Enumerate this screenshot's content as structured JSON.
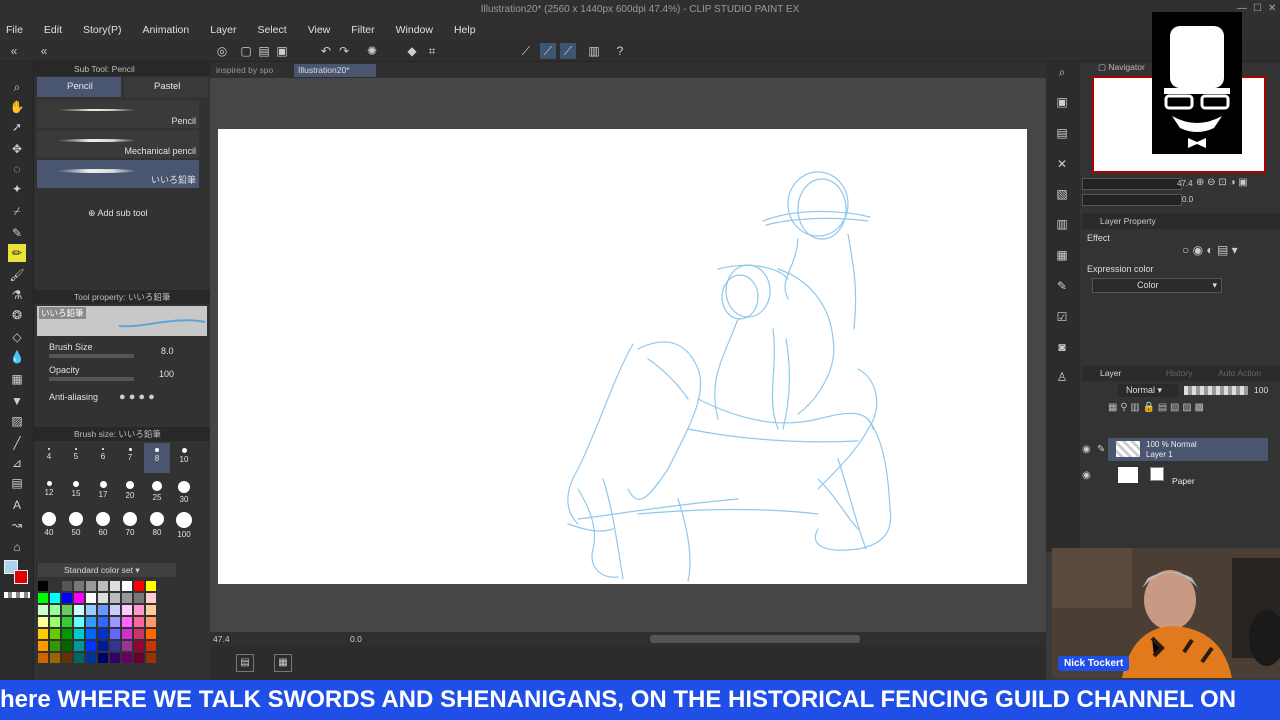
{
  "window": {
    "title": "Illustration20* (2560 x 1440px 600dpi 47.4%) - CLIP STUDIO PAINT EX"
  },
  "menu": [
    "File",
    "Edit",
    "Story(P)",
    "Animation",
    "Layer",
    "Select",
    "View",
    "Filter",
    "Window",
    "Help"
  ],
  "subtool": {
    "header": "Sub Tool: Pencil",
    "tabs": [
      "Pencil",
      "Pastel"
    ],
    "brushes": [
      "Pencil",
      "Mechanical pencil",
      "いいろ鉛筆"
    ],
    "add_label": "Add sub tool"
  },
  "tool_property": {
    "header": "Tool property: いいろ鉛筆",
    "preview_label": "いいろ鉛筆",
    "brush_size_label": "Brush Size",
    "brush_size_value": "8.0",
    "opacity_label": "Opacity",
    "opacity_value": "100",
    "antialiasing_label": "Anti-aliasing"
  },
  "brush_size_panel": {
    "header": "Brush size: いいろ鉛筆",
    "sizes": [
      "4",
      "5",
      "6",
      "7",
      "8",
      "10",
      "12",
      "15",
      "17",
      "20",
      "25",
      "30",
      "40",
      "50",
      "60",
      "70",
      "80",
      "100"
    ],
    "selected": "8"
  },
  "color_set": {
    "name": "Standard color set",
    "main_color": "#a8d4f0",
    "sub_color": "#e00000"
  },
  "doc_tabs": [
    "inspired by spo",
    "Illustration20*"
  ],
  "canvas": {
    "zoom": "47.4",
    "rotation": "0.0",
    "stroke_color": "#8fc8ee"
  },
  "navigator": {
    "title": "Navigator",
    "zoom_value": "47.4",
    "rotation_value": "0.0"
  },
  "layer_property": {
    "title": "Layer Property",
    "effect_label": "Effect",
    "expression_label": "Expression color",
    "expression_value": "Color"
  },
  "layer_panel": {
    "tabs": [
      "Layer",
      "History",
      "Auto Action"
    ],
    "blend_mode": "Normal",
    "opacity": "100",
    "layers": [
      {
        "line1": "100 % Normal",
        "line2": "Layer 1"
      },
      {
        "line1": "",
        "line2": "Paper"
      }
    ]
  },
  "webcam": {
    "name": "Nick Tockert"
  },
  "ticker": {
    "text": "here WHERE WE TALK SWORDS AND SHENANIGANS, ON THE HISTORICAL FENCING GUILD CHANNEL ON"
  }
}
